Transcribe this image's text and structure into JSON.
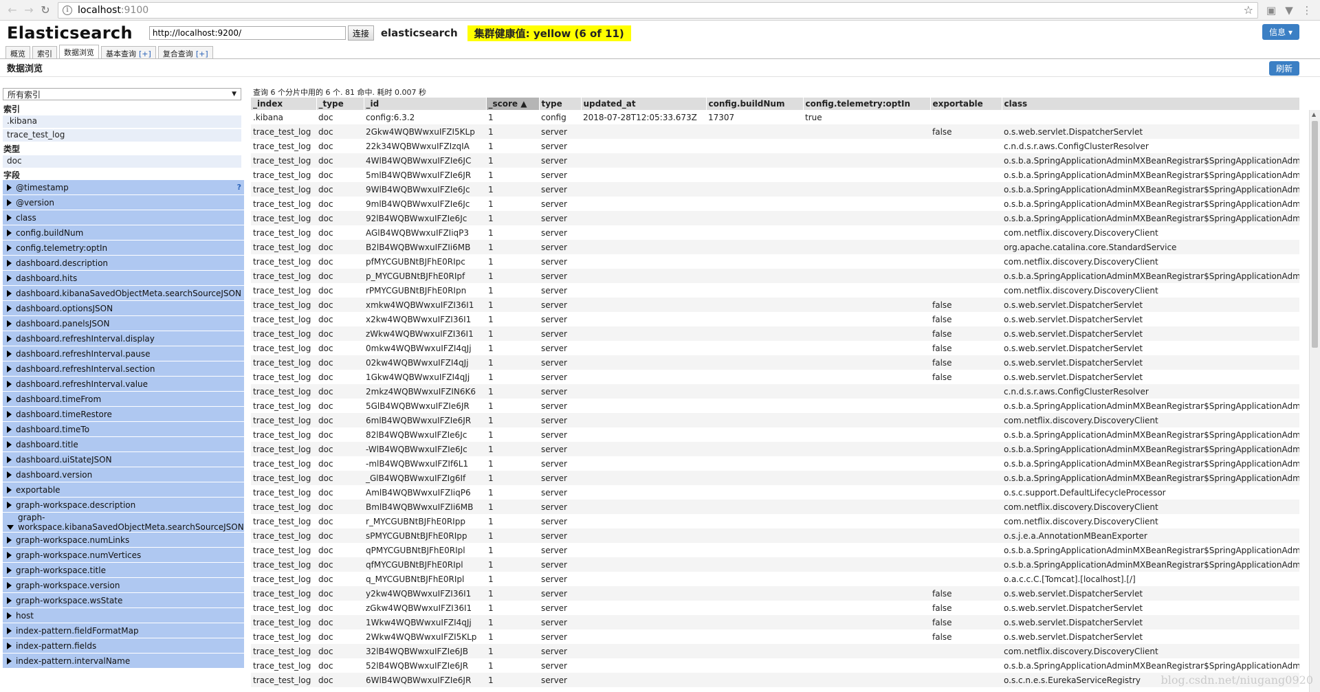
{
  "browser": {
    "url_host": "localhost",
    "url_port": ":9100"
  },
  "header": {
    "logo": "Elasticsearch",
    "connect_url": "http://localhost:9200/",
    "connect_label": "连接",
    "cluster_name": "elasticsearch",
    "health": "集群健康值: yellow (6 of 11)",
    "info_label": "信息 ▾"
  },
  "tabs": [
    {
      "label": "概览"
    },
    {
      "label": "索引"
    },
    {
      "label": "数据浏览"
    },
    {
      "label": "基本查询",
      "plus": "[+]"
    },
    {
      "label": "复合查询",
      "plus": "[+]"
    }
  ],
  "section": {
    "title": "数据浏览",
    "refresh_label": "刷新"
  },
  "sidebar": {
    "select_value": "所有索引",
    "index_label": "索引",
    "indices": [
      ".kibana",
      "trace_test_log"
    ],
    "type_label": "类型",
    "types": [
      "doc"
    ],
    "field_label": "字段",
    "fields": [
      "@timestamp",
      "@version",
      "class",
      "config.buildNum",
      "config.telemetry:optIn",
      "dashboard.description",
      "dashboard.hits",
      "dashboard.kibanaSavedObjectMeta.searchSourceJSON",
      "dashboard.optionsJSON",
      "dashboard.panelsJSON",
      "dashboard.refreshInterval.display",
      "dashboard.refreshInterval.pause",
      "dashboard.refreshInterval.section",
      "dashboard.refreshInterval.value",
      "dashboard.timeFrom",
      "dashboard.timeRestore",
      "dashboard.timeTo",
      "dashboard.title",
      "dashboard.uiStateJSON",
      "dashboard.version",
      "exportable",
      "graph-workspace.description"
    ],
    "tall_field": [
      "graph-",
      "workspace.kibanaSavedObjectMeta.searchSourceJSON"
    ],
    "fields_after": [
      "graph-workspace.numLinks",
      "graph-workspace.numVertices",
      "graph-workspace.title",
      "graph-workspace.version",
      "graph-workspace.wsState",
      "host",
      "index-pattern.fieldFormatMap",
      "index-pattern.fields",
      "index-pattern.intervalName"
    ]
  },
  "results": {
    "summary": "查询 6 个分片中用的 6 个. 81 命中. 耗时 0.007 秒",
    "columns": [
      "_index",
      "_type",
      "_id",
      "_score ▲",
      "type",
      "updated_at",
      "config.buildNum",
      "config.telemetry:optIn",
      "exportable",
      "class"
    ],
    "rows": [
      [
        ".kibana",
        "doc",
        "config:6.3.2",
        "1",
        "config",
        "2018-07-28T12:05:33.673Z",
        "17307",
        "true",
        "",
        ""
      ],
      [
        "trace_test_log",
        "doc",
        "2Gkw4WQBWwxuIFZI5KLp",
        "1",
        "server",
        "",
        "",
        "",
        "false",
        "o.s.web.servlet.DispatcherServlet"
      ],
      [
        "trace_test_log",
        "doc",
        "22k34WQBWwxuIFZIzqIA",
        "1",
        "server",
        "",
        "",
        "",
        "",
        "c.n.d.s.r.aws.ConfigClusterResolver"
      ],
      [
        "trace_test_log",
        "doc",
        "4WlB4WQBWwxuIFZIe6JC",
        "1",
        "server",
        "",
        "",
        "",
        "",
        "o.s.b.a.SpringApplicationAdminMXBeanRegistrar$SpringApplicationAdm"
      ],
      [
        "trace_test_log",
        "doc",
        "5mlB4WQBWwxuIFZIe6JR",
        "1",
        "server",
        "",
        "",
        "",
        "",
        "o.s.b.a.SpringApplicationAdminMXBeanRegistrar$SpringApplicationAdm"
      ],
      [
        "trace_test_log",
        "doc",
        "9WlB4WQBWwxuIFZIe6Jc",
        "1",
        "server",
        "",
        "",
        "",
        "",
        "o.s.b.a.SpringApplicationAdminMXBeanRegistrar$SpringApplicationAdm"
      ],
      [
        "trace_test_log",
        "doc",
        "9mlB4WQBWwxuIFZIe6Jc",
        "1",
        "server",
        "",
        "",
        "",
        "",
        "o.s.b.a.SpringApplicationAdminMXBeanRegistrar$SpringApplicationAdm"
      ],
      [
        "trace_test_log",
        "doc",
        "92lB4WQBWwxuIFZIe6Jc",
        "1",
        "server",
        "",
        "",
        "",
        "",
        "o.s.b.a.SpringApplicationAdminMXBeanRegistrar$SpringApplicationAdm"
      ],
      [
        "trace_test_log",
        "doc",
        "AGlB4WQBWwxuIFZIiqP3",
        "1",
        "server",
        "",
        "",
        "",
        "",
        "com.netflix.discovery.DiscoveryClient"
      ],
      [
        "trace_test_log",
        "doc",
        "B2lB4WQBWwxuIFZIi6MB",
        "1",
        "server",
        "",
        "",
        "",
        "",
        "org.apache.catalina.core.StandardService"
      ],
      [
        "trace_test_log",
        "doc",
        "pfMYCGUBNtBJFhE0RIpc",
        "1",
        "server",
        "",
        "",
        "",
        "",
        "com.netflix.discovery.DiscoveryClient"
      ],
      [
        "trace_test_log",
        "doc",
        "p_MYCGUBNtBJFhE0RIpf",
        "1",
        "server",
        "",
        "",
        "",
        "",
        "o.s.b.a.SpringApplicationAdminMXBeanRegistrar$SpringApplicationAdm"
      ],
      [
        "trace_test_log",
        "doc",
        "rPMYCGUBNtBJFhE0RIpn",
        "1",
        "server",
        "",
        "",
        "",
        "",
        "com.netflix.discovery.DiscoveryClient"
      ],
      [
        "trace_test_log",
        "doc",
        "xmkw4WQBWwxuIFZI36I1",
        "1",
        "server",
        "",
        "",
        "",
        "false",
        "o.s.web.servlet.DispatcherServlet"
      ],
      [
        "trace_test_log",
        "doc",
        "x2kw4WQBWwxuIFZI36I1",
        "1",
        "server",
        "",
        "",
        "",
        "false",
        "o.s.web.servlet.DispatcherServlet"
      ],
      [
        "trace_test_log",
        "doc",
        "zWkw4WQBWwxuIFZI36I1",
        "1",
        "server",
        "",
        "",
        "",
        "false",
        "o.s.web.servlet.DispatcherServlet"
      ],
      [
        "trace_test_log",
        "doc",
        "0mkw4WQBWwxuIFZI4qJj",
        "1",
        "server",
        "",
        "",
        "",
        "false",
        "o.s.web.servlet.DispatcherServlet"
      ],
      [
        "trace_test_log",
        "doc",
        "02kw4WQBWwxuIFZI4qJj",
        "1",
        "server",
        "",
        "",
        "",
        "false",
        "o.s.web.servlet.DispatcherServlet"
      ],
      [
        "trace_test_log",
        "doc",
        "1Gkw4WQBWwxuIFZI4qJj",
        "1",
        "server",
        "",
        "",
        "",
        "false",
        "o.s.web.servlet.DispatcherServlet"
      ],
      [
        "trace_test_log",
        "doc",
        "2mkz4WQBWwxuIFZIN6K6",
        "1",
        "server",
        "",
        "",
        "",
        "",
        "c.n.d.s.r.aws.ConfigClusterResolver"
      ],
      [
        "trace_test_log",
        "doc",
        "5GlB4WQBWwxuIFZIe6JR",
        "1",
        "server",
        "",
        "",
        "",
        "",
        "o.s.b.a.SpringApplicationAdminMXBeanRegistrar$SpringApplicationAdm"
      ],
      [
        "trace_test_log",
        "doc",
        "6mlB4WQBWwxuIFZIe6JR",
        "1",
        "server",
        "",
        "",
        "",
        "",
        "com.netflix.discovery.DiscoveryClient"
      ],
      [
        "trace_test_log",
        "doc",
        "82lB4WQBWwxuIFZIe6Jc",
        "1",
        "server",
        "",
        "",
        "",
        "",
        "o.s.b.a.SpringApplicationAdminMXBeanRegistrar$SpringApplicationAdm"
      ],
      [
        "trace_test_log",
        "doc",
        "-WlB4WQBWwxuIFZIe6Jc",
        "1",
        "server",
        "",
        "",
        "",
        "",
        "o.s.b.a.SpringApplicationAdminMXBeanRegistrar$SpringApplicationAdm"
      ],
      [
        "trace_test_log",
        "doc",
        "-mlB4WQBWwxuIFZIf6L1",
        "1",
        "server",
        "",
        "",
        "",
        "",
        "o.s.b.a.SpringApplicationAdminMXBeanRegistrar$SpringApplicationAdm"
      ],
      [
        "trace_test_log",
        "doc",
        "_GlB4WQBWwxuIFZIg6If",
        "1",
        "server",
        "",
        "",
        "",
        "",
        "o.s.b.a.SpringApplicationAdminMXBeanRegistrar$SpringApplicationAdm"
      ],
      [
        "trace_test_log",
        "doc",
        "AmlB4WQBWwxuIFZIiqP6",
        "1",
        "server",
        "",
        "",
        "",
        "",
        "o.s.c.support.DefaultLifecycleProcessor"
      ],
      [
        "trace_test_log",
        "doc",
        "BmlB4WQBWwxuIFZIi6MB",
        "1",
        "server",
        "",
        "",
        "",
        "",
        "com.netflix.discovery.DiscoveryClient"
      ],
      [
        "trace_test_log",
        "doc",
        "r_MYCGUBNtBJFhE0RIpp",
        "1",
        "server",
        "",
        "",
        "",
        "",
        "com.netflix.discovery.DiscoveryClient"
      ],
      [
        "trace_test_log",
        "doc",
        "sPMYCGUBNtBJFhE0RIpp",
        "1",
        "server",
        "",
        "",
        "",
        "",
        "o.s.j.e.a.AnnotationMBeanExporter"
      ],
      [
        "trace_test_log",
        "doc",
        "qPMYCGUBNtBJFhE0RIpl",
        "1",
        "server",
        "",
        "",
        "",
        "",
        "o.s.b.a.SpringApplicationAdminMXBeanRegistrar$SpringApplicationAdm"
      ],
      [
        "trace_test_log",
        "doc",
        "qfMYCGUBNtBJFhE0RIpl",
        "1",
        "server",
        "",
        "",
        "",
        "",
        "o.s.b.a.SpringApplicationAdminMXBeanRegistrar$SpringApplicationAdm"
      ],
      [
        "trace_test_log",
        "doc",
        "q_MYCGUBNtBJFhE0RIpl",
        "1",
        "server",
        "",
        "",
        "",
        "",
        "o.a.c.c.C.[Tomcat].[localhost].[/]"
      ],
      [
        "trace_test_log",
        "doc",
        "y2kw4WQBWwxuIFZI36I1",
        "1",
        "server",
        "",
        "",
        "",
        "false",
        "o.s.web.servlet.DispatcherServlet"
      ],
      [
        "trace_test_log",
        "doc",
        "zGkw4WQBWwxuIFZI36I1",
        "1",
        "server",
        "",
        "",
        "",
        "false",
        "o.s.web.servlet.DispatcherServlet"
      ],
      [
        "trace_test_log",
        "doc",
        "1Wkw4WQBWwxuIFZI4qJj",
        "1",
        "server",
        "",
        "",
        "",
        "false",
        "o.s.web.servlet.DispatcherServlet"
      ],
      [
        "trace_test_log",
        "doc",
        "2Wkw4WQBWwxuIFZI5KLp",
        "1",
        "server",
        "",
        "",
        "",
        "false",
        "o.s.web.servlet.DispatcherServlet"
      ],
      [
        "trace_test_log",
        "doc",
        "32lB4WQBWwxuIFZIe6JB",
        "1",
        "server",
        "",
        "",
        "",
        "",
        "com.netflix.discovery.DiscoveryClient"
      ],
      [
        "trace_test_log",
        "doc",
        "52lB4WQBWwxuIFZIe6JR",
        "1",
        "server",
        "",
        "",
        "",
        "",
        "o.s.b.a.SpringApplicationAdminMXBeanRegistrar$SpringApplicationAdm"
      ],
      [
        "trace_test_log",
        "doc",
        "6WlB4WQBWwxuIFZIe6JR",
        "1",
        "server",
        "",
        "",
        "",
        "",
        "o.s.c.n.e.s.EurekaServiceRegistry"
      ]
    ]
  },
  "watermark": "blog.csdn.net/niugang0920"
}
